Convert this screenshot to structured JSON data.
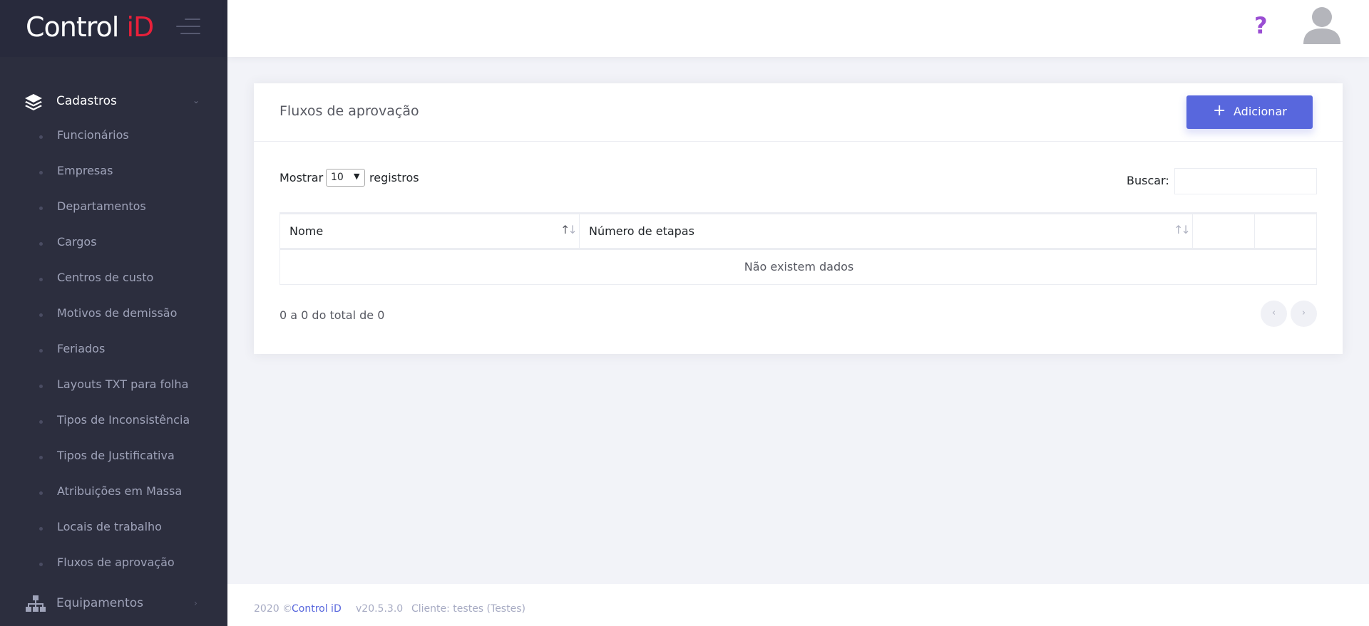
{
  "brand": {
    "logo_text_main": "Control ",
    "logo_text_accent": "iD",
    "accent_color": "#e8203a"
  },
  "sidebar": {
    "section": {
      "label": "Cadastros",
      "icon": "layers-icon"
    },
    "items": [
      {
        "label": "Funcionários"
      },
      {
        "label": "Empresas"
      },
      {
        "label": "Departamentos"
      },
      {
        "label": "Cargos"
      },
      {
        "label": "Centros de custo"
      },
      {
        "label": "Motivos de demissão"
      },
      {
        "label": "Feriados"
      },
      {
        "label": "Layouts TXT para folha"
      },
      {
        "label": "Tipos de Inconsistência"
      },
      {
        "label": "Tipos de Justificativa"
      },
      {
        "label": "Atribuições em Massa"
      },
      {
        "label": "Locais de trabalho"
      },
      {
        "label": "Fluxos de aprovação"
      }
    ],
    "section2": {
      "label": "Equipamentos",
      "icon": "sitemap-icon"
    }
  },
  "header": {
    "help_icon": "question-icon",
    "help_glyph": "?",
    "help_color": "#9a4dd3",
    "avatar_icon": "user-avatar-icon"
  },
  "page": {
    "title": "Fluxos de aprovação",
    "add_button": {
      "plus": "+",
      "label": "Adicionar"
    },
    "button_color": "#5867dd"
  },
  "table_controls": {
    "show_prefix": "Mostrar",
    "page_size": "10",
    "show_suffix": "registros",
    "search_label": "Buscar:",
    "search_value": ""
  },
  "table": {
    "columns": [
      {
        "label": "Nome"
      },
      {
        "label": "Número de etapas"
      },
      {
        "label": ""
      },
      {
        "label": ""
      }
    ],
    "empty_message": "Não existem dados",
    "info": "0 a 0 do total de 0",
    "prev_glyph": "‹",
    "next_glyph": "›"
  },
  "footer": {
    "copyright_prefix": "2020 ©",
    "brand": "Control iD",
    "version": "v20.5.3.0",
    "client": "Cliente: testes (Testes)"
  }
}
